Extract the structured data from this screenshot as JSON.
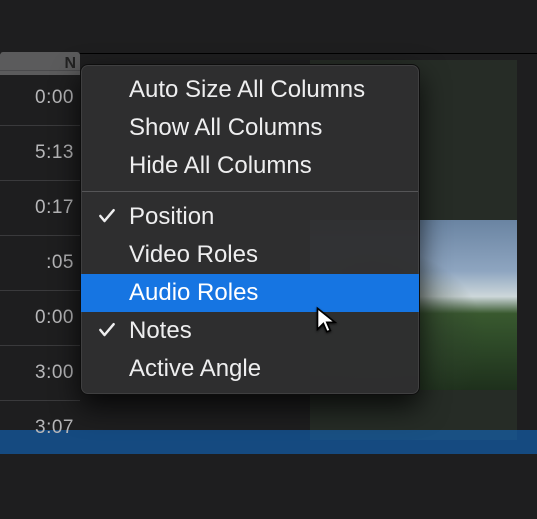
{
  "timeline": {
    "times": [
      "0:00",
      "5:13",
      "0:17",
      ":05",
      "0:00",
      "3:00",
      "3:07"
    ]
  },
  "column_handle": {
    "truncated_label": "N"
  },
  "context_menu": {
    "section_a": [
      {
        "label": "Auto Size All Columns",
        "checked": false,
        "highlighted": false
      },
      {
        "label": "Show All Columns",
        "checked": false,
        "highlighted": false
      },
      {
        "label": "Hide All Columns",
        "checked": false,
        "highlighted": false
      }
    ],
    "section_b": [
      {
        "label": "Position",
        "checked": true,
        "highlighted": false
      },
      {
        "label": "Video Roles",
        "checked": false,
        "highlighted": false
      },
      {
        "label": "Audio Roles",
        "checked": false,
        "highlighted": true
      },
      {
        "label": "Notes",
        "checked": true,
        "highlighted": false
      },
      {
        "label": "Active Angle",
        "checked": false,
        "highlighted": false
      }
    ]
  }
}
